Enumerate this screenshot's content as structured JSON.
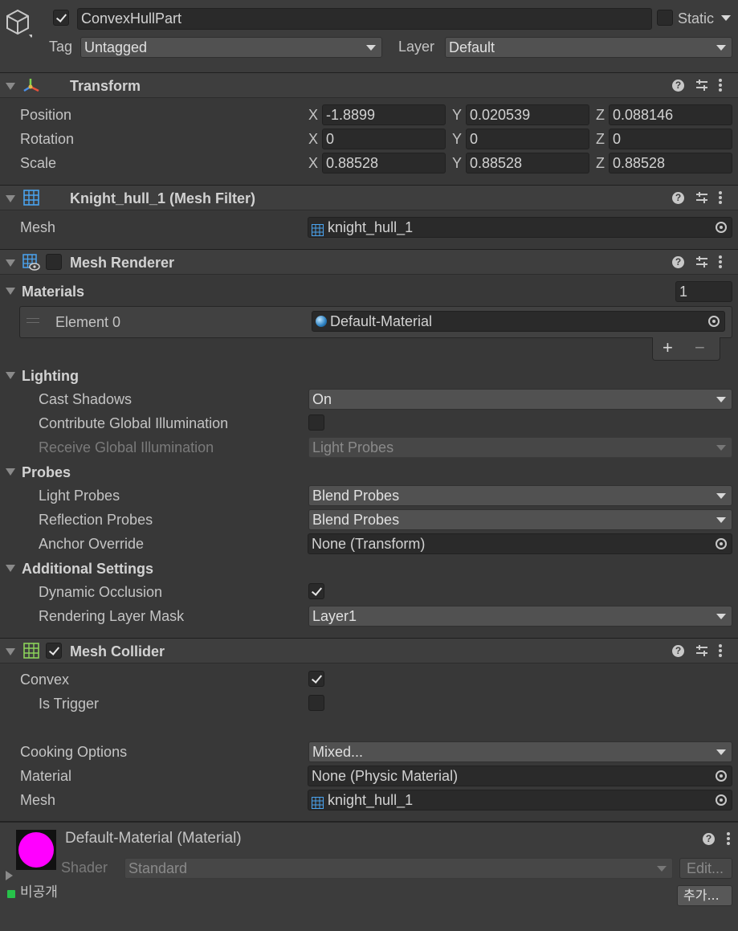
{
  "object": {
    "name": "ConvexHullPart",
    "static_label": "Static",
    "tag_label": "Tag",
    "tag_value": "Untagged",
    "layer_label": "Layer",
    "layer_value": "Default"
  },
  "transform": {
    "title": "Transform",
    "rows": [
      {
        "label": "Position",
        "x": "-1.8899",
        "y": "0.020539",
        "z": "0.088146"
      },
      {
        "label": "Rotation",
        "x": "0",
        "y": "0",
        "z": "0"
      },
      {
        "label": "Scale",
        "x": "0.88528",
        "y": "0.88528",
        "z": "0.88528"
      }
    ],
    "axis_x": "X",
    "axis_y": "Y",
    "axis_z": "Z"
  },
  "mesh_filter": {
    "title": "Knight_hull_1 (Mesh Filter)",
    "mesh_label": "Mesh",
    "mesh_value": "knight_hull_1"
  },
  "mesh_renderer": {
    "title": "Mesh Renderer",
    "materials_label": "Materials",
    "materials_count": "1",
    "element0_label": "Element 0",
    "element0_value": "Default-Material",
    "plus": "+",
    "minus": "−",
    "lighting_label": "Lighting",
    "cast_shadows_label": "Cast Shadows",
    "cast_shadows_value": "On",
    "contribute_gi_label": "Contribute Global Illumination",
    "receive_gi_label": "Receive Global Illumination",
    "receive_gi_value": "Light Probes",
    "probes_label": "Probes",
    "light_probes_label": "Light Probes",
    "light_probes_value": "Blend Probes",
    "reflection_probes_label": "Reflection Probes",
    "reflection_probes_value": "Blend Probes",
    "anchor_override_label": "Anchor Override",
    "anchor_override_value": "None (Transform)",
    "additional_label": "Additional Settings",
    "dynamic_occlusion_label": "Dynamic Occlusion",
    "rendering_layer_label": "Rendering Layer Mask",
    "rendering_layer_value": "Layer1"
  },
  "mesh_collider": {
    "title": "Mesh Collider",
    "convex_label": "Convex",
    "is_trigger_label": "Is Trigger",
    "cooking_label": "Cooking Options",
    "cooking_value": "Mixed...",
    "material_label": "Material",
    "material_value": "None (Physic Material)",
    "mesh_label": "Mesh",
    "mesh_value": "knight_hull_1"
  },
  "material_preview": {
    "title": "Default-Material (Material)",
    "shader_label": "Shader",
    "shader_value": "Standard",
    "edit_button": "Edit...",
    "swatch_color": "#ff00ff"
  },
  "footer": {
    "private_label": "비공개",
    "add_button": "추가..."
  }
}
